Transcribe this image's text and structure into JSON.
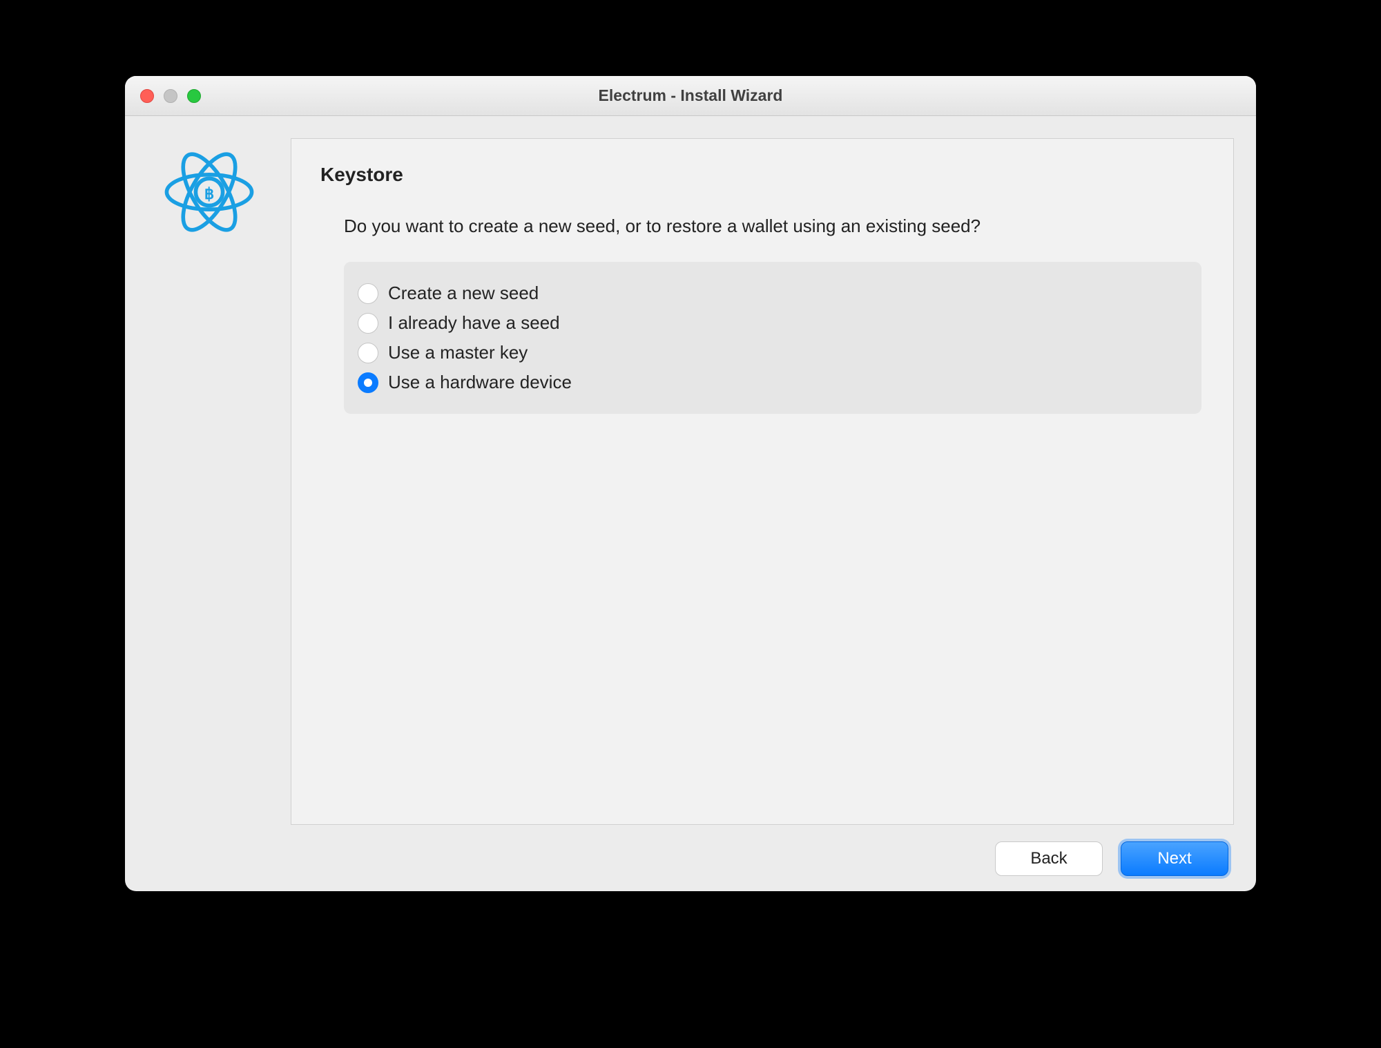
{
  "window": {
    "title": "Electrum  -  Install Wizard"
  },
  "content": {
    "heading": "Keystore",
    "prompt": "Do you want to create a new seed, or to restore a wallet using an existing seed?"
  },
  "options": [
    {
      "label": "Create a new seed",
      "selected": false
    },
    {
      "label": "I already have a seed",
      "selected": false
    },
    {
      "label": "Use a master key",
      "selected": false
    },
    {
      "label": "Use a hardware device",
      "selected": true
    }
  ],
  "buttons": {
    "back": "Back",
    "next": "Next"
  }
}
